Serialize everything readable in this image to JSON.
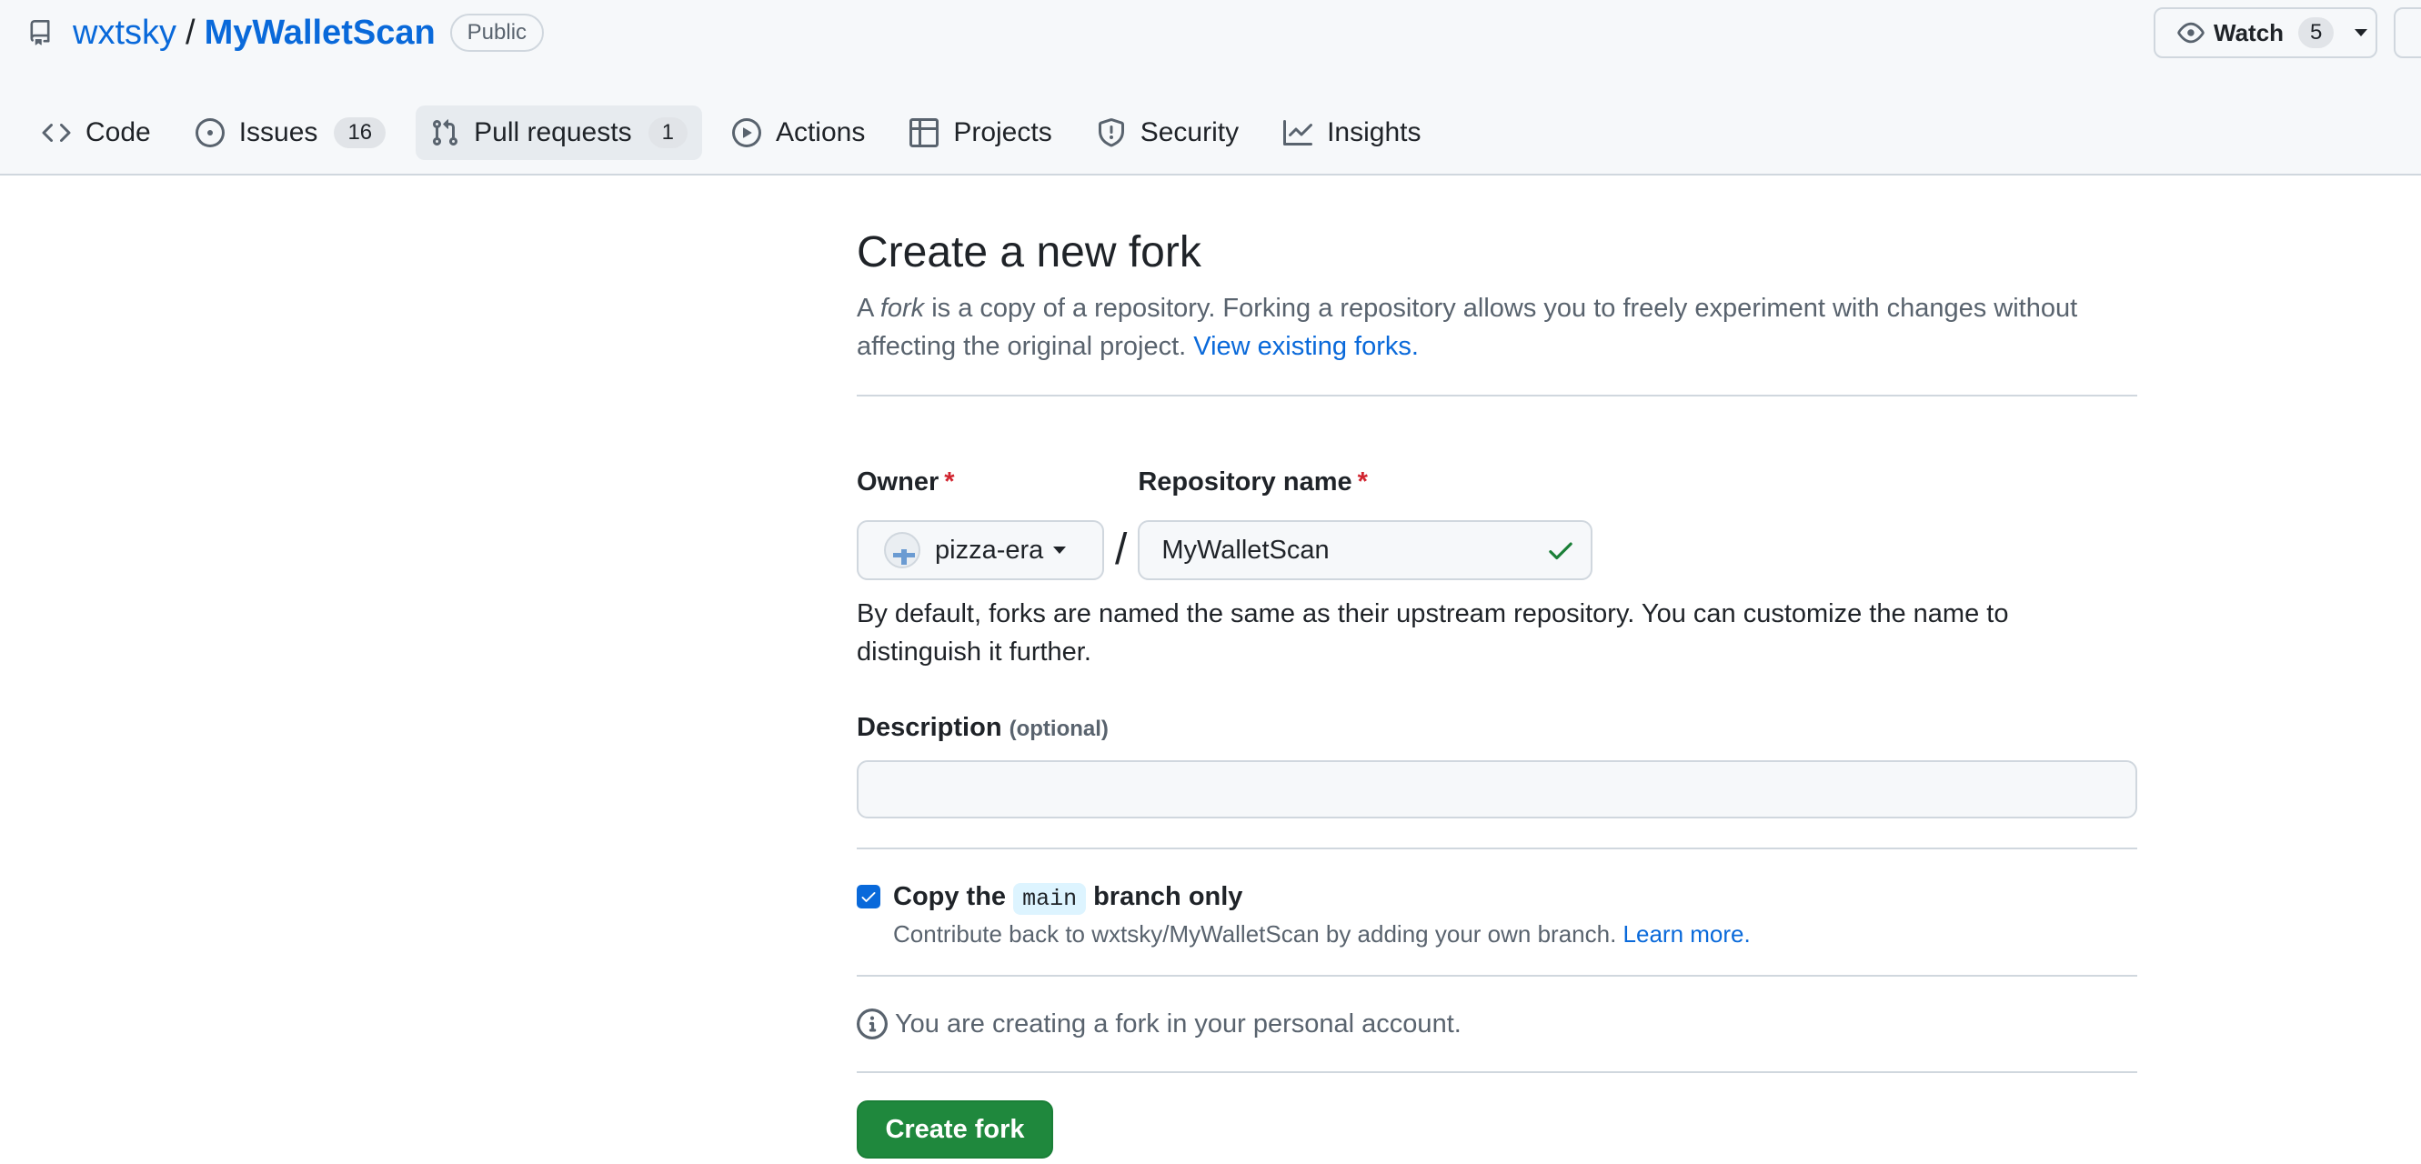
{
  "repo": {
    "owner": "wxtsky",
    "separator": "/",
    "name": "MyWalletScan",
    "visibility": "Public"
  },
  "watch": {
    "label": "Watch",
    "count": "5"
  },
  "tabs": [
    {
      "label": "Code",
      "icon": "code-icon"
    },
    {
      "label": "Issues",
      "icon": "issue-icon",
      "count": "16"
    },
    {
      "label": "Pull requests",
      "icon": "pull-request-icon",
      "count": "1",
      "active": true
    },
    {
      "label": "Actions",
      "icon": "play-icon"
    },
    {
      "label": "Projects",
      "icon": "table-icon"
    },
    {
      "label": "Security",
      "icon": "shield-icon"
    },
    {
      "label": "Insights",
      "icon": "graph-icon"
    }
  ],
  "form": {
    "title": "Create a new fork",
    "lead_a": "A ",
    "lead_fork": "fork",
    "lead_rest": " is a copy of a repository. Forking a repository allows you to freely experiment with changes without affecting the original project.",
    "lead_link": "View existing forks.",
    "owner_label": "Owner",
    "required_mark": "*",
    "owner_value": "pizza-era",
    "slash": "/",
    "repo_label": "Repository name",
    "repo_value": "MyWalletScan",
    "help_text": "By default, forks are named the same as their upstream repository. You can customize the name to distinguish it further.",
    "description_label": "Description",
    "description_optional": "(optional)",
    "description_value": "",
    "copy_prefix": "Copy the",
    "copy_branch": "main",
    "copy_suffix": "branch only",
    "copy_checked": true,
    "copy_sub": "Contribute back to wxtsky/MyWalletScan by adding your own branch.",
    "copy_learn": "Learn more.",
    "info_text": "You are creating a fork in your personal account.",
    "submit_label": "Create fork"
  },
  "colors": {
    "accent": "#0969da",
    "primary_button": "#1f883d",
    "success_check": "#1a7f37",
    "required": "#d1242f"
  }
}
